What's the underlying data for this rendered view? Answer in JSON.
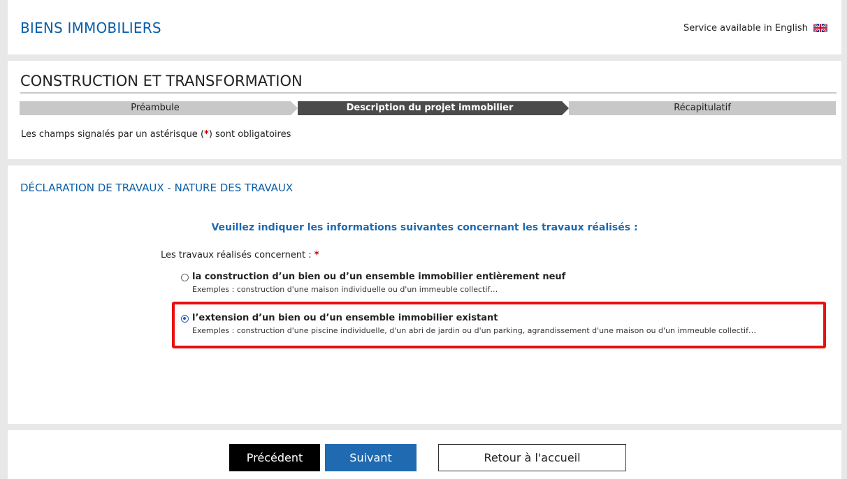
{
  "header": {
    "app_title": "BIENS IMMOBILIERS",
    "lang_link": "Service available in English",
    "flag_icon": "uk-flag-icon"
  },
  "section": {
    "title": "CONSTRUCTION ET TRANSFORMATION",
    "steps": [
      {
        "label": "Préambule",
        "state": "inactive"
      },
      {
        "label": "Description du projet immobilier",
        "state": "active"
      },
      {
        "label": "Récapitulatif",
        "state": "inactive"
      }
    ],
    "required_note_prefix": "Les champs signalés par un astérisque  (",
    "required_note_star": "*",
    "required_note_suffix": ")  sont obligatoires"
  },
  "form": {
    "subtitle": "DÉCLARATION DE TRAVAUX - NATURE DES TRAVAUX",
    "instructions": "Veuillez indiquer les informations suivantes concernant les travaux réalisés :",
    "question": "Les travaux réalisés concernent : ",
    "question_star": "*",
    "options": [
      {
        "label": "la construction d’un bien ou d’un ensemble immobilier entièrement neuf",
        "example": "Exemples : construction d'une maison individuelle ou d'un immeuble collectif…",
        "checked": false
      },
      {
        "label": "l’extension d’un bien ou d’un ensemble immobilier existant",
        "example": "Exemples : construction d'une piscine individuelle, d'un abri de jardin ou d'un parking, agrandissement d'une maison ou d'un immeuble collectif…",
        "checked": true
      }
    ]
  },
  "nav": {
    "prev_label": "Précédent",
    "next_label": "Suivant",
    "home_label": "Retour à l'accueil"
  },
  "colors": {
    "brand_blue": "#0a5ea8",
    "button_blue": "#1f6ab0",
    "highlight_red": "#e81010",
    "step_active": "#4b4b4b",
    "step_inactive": "#c8c8c8"
  }
}
